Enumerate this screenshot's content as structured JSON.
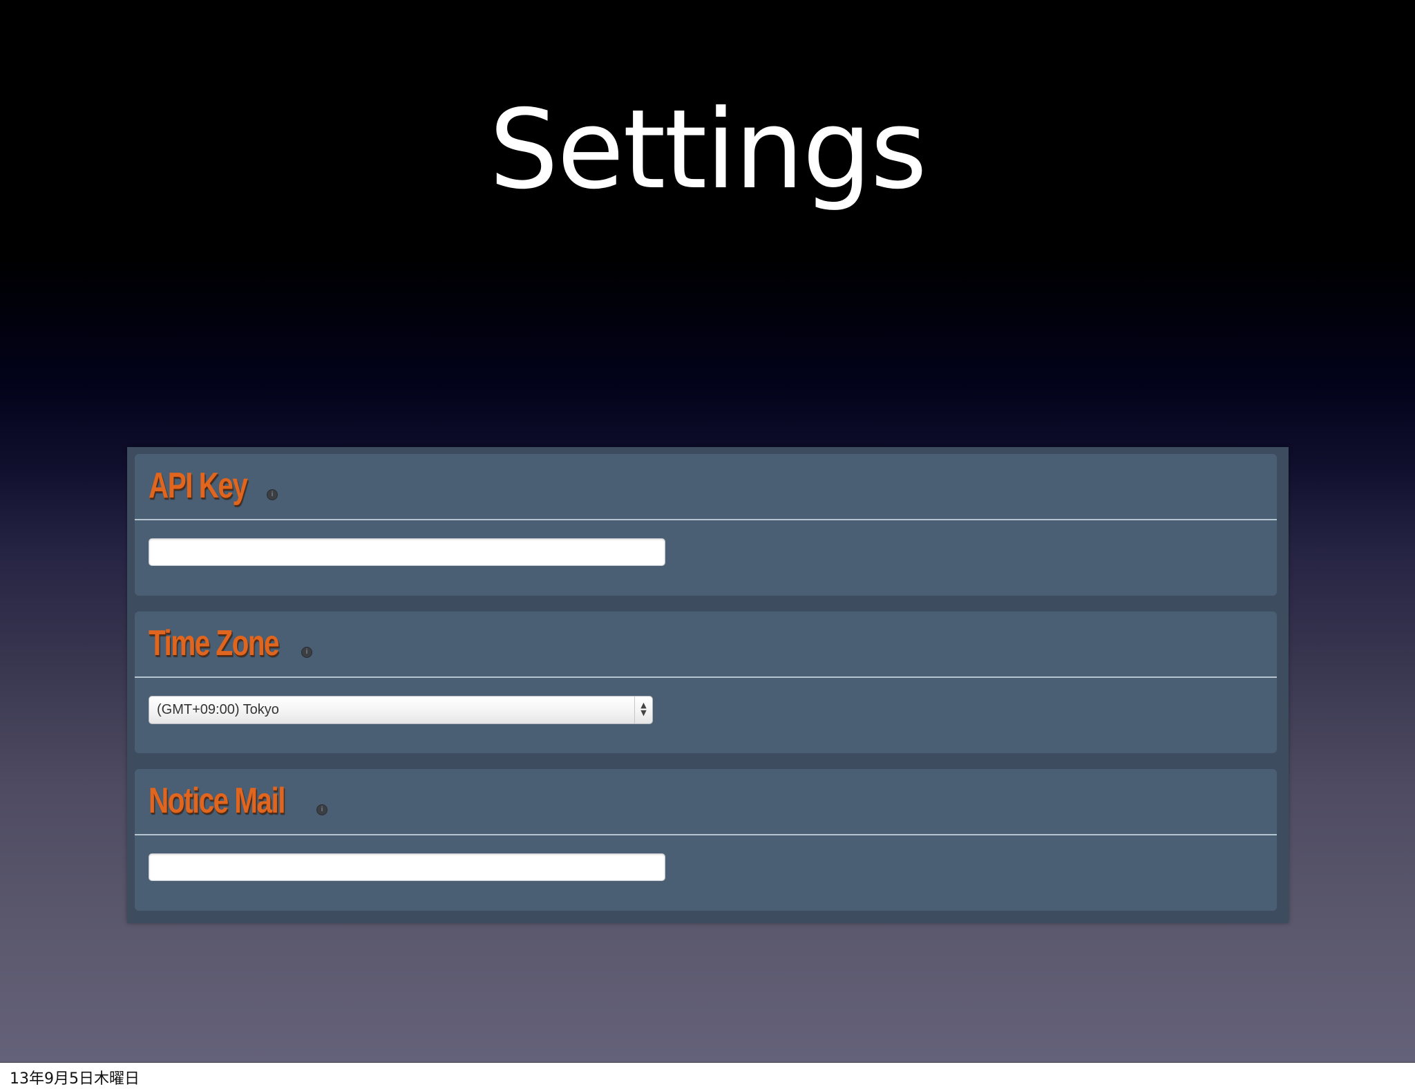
{
  "slide": {
    "title": "Settings",
    "footer_date": "13年9月5日木曜日"
  },
  "settings": {
    "sections": [
      {
        "label": "API Key",
        "help_icon": "info-icon",
        "input_value": ""
      },
      {
        "label": "Time Zone",
        "help_icon": "info-icon",
        "selected": "(GMT+09:00) Tokyo",
        "arrow_icon": "up-down-arrows-icon"
      },
      {
        "label": "Notice Mail",
        "help_icon": "info-icon",
        "input_value": ""
      }
    ]
  },
  "colors": {
    "label_orange": "#e0651f",
    "panel_bg": "#4a5f73",
    "panel_frame": "#3e4c5f"
  }
}
